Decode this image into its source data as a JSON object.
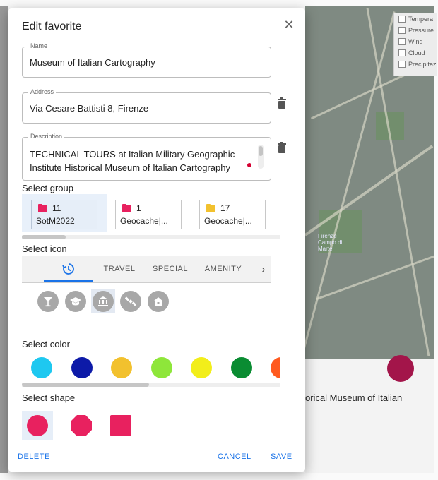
{
  "dialog": {
    "title": "Edit favorite",
    "close_glyph": "✕",
    "name": {
      "label": "Name",
      "value": "Museum of Italian Cartography"
    },
    "address": {
      "label": "Address",
      "value": "Via Cesare Battisti 8, Firenze"
    },
    "description": {
      "label": "Description",
      "value": "TECHNICAL TOURS at Italian Military Geographic Institute Historical Museum of Italian Cartography"
    },
    "select_group_label": "Select group",
    "groups": [
      {
        "count": "11",
        "name": "SotM2022",
        "color": "#e8215f",
        "selected": true
      },
      {
        "count": "1",
        "name": "Geocache|...",
        "color": "#e8215f",
        "selected": false
      },
      {
        "count": "17",
        "name": "Geocache|...",
        "color": "#f2c12e",
        "selected": false
      }
    ],
    "select_icon_label": "Select icon",
    "icon_tabs": [
      {
        "label": "history-icon",
        "active": true
      },
      {
        "label": "TRAVEL"
      },
      {
        "label": "SPECIAL"
      },
      {
        "label": "AMENITY"
      }
    ],
    "icons": [
      "cocktail-icon",
      "graduation-cap-icon",
      "museum-icon",
      "satellite-icon",
      "home-icon"
    ],
    "selected_icon": "museum-icon",
    "select_color_label": "Select color",
    "colors": [
      "#1ec8f0",
      "#0d1aa8",
      "#f2c12e",
      "#8ee63a",
      "#f2ee1a",
      "#0a8c32",
      "#ff5a1f"
    ],
    "select_shape_label": "Select shape",
    "shapes": [
      "circle",
      "octagon",
      "square"
    ],
    "selected_shape": "circle",
    "shape_color": "#e8215f",
    "actions": {
      "delete": "DELETE",
      "cancel": "CANCEL",
      "save": "SAVE"
    },
    "accent": "#1a73e8"
  },
  "background": {
    "map_layers": [
      "Tempera",
      "Pressure",
      "Wind",
      "Cloud",
      "Precipitaz"
    ],
    "map_labels": [
      "Firenze Campo di Marte"
    ],
    "below_map_text": "orical Museum of Italian",
    "pin_color": "#a3154a"
  }
}
